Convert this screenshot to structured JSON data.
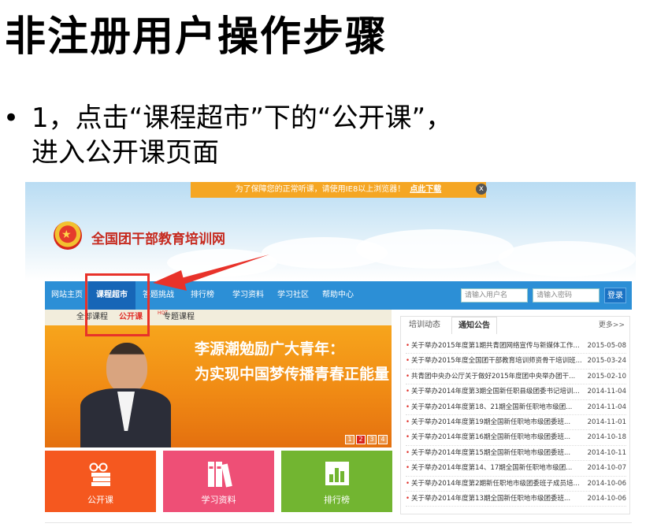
{
  "slide": {
    "title": "非注册用户操作步骤",
    "bullet": "•",
    "line1": "1，点击“课程超市”下的“公开课”，",
    "line2": "进入公开课页面"
  },
  "notice": {
    "text": "为了保障您的正常听课，请使用IE8以上浏览器！",
    "link": "点此下载",
    "close": "x"
  },
  "site": {
    "name": "全国团干部教育培训网"
  },
  "nav": {
    "items": [
      "网站主页",
      "课程超市",
      "答题挑战",
      "排行榜",
      "学习资料",
      "学习社区",
      "帮助中心"
    ],
    "active": "课程超市",
    "username_placeholder": "请输入用户名",
    "password_placeholder": "请输入密码",
    "login": "登录"
  },
  "subnav": {
    "items": [
      "全部课程",
      "公开课",
      "专题课程"
    ],
    "active": "公开课",
    "hot": "HOT"
  },
  "banner": {
    "line1": "李源潮勉励广大青年：",
    "line2": "为实现中国梦传播青春正能量",
    "pages": [
      "1",
      "2",
      "3",
      "4"
    ],
    "active_page": "2"
  },
  "tiles": [
    {
      "label": "公开课",
      "color": "#f5581f"
    },
    {
      "label": "学习资料",
      "color": "#ee4f76"
    },
    {
      "label": "排行榜",
      "color": "#72b531"
    }
  ],
  "news": {
    "tabs": [
      "培训动态",
      "通知公告"
    ],
    "active_tab": "通知公告",
    "more": "更多>>",
    "bullet": "•",
    "rows": [
      {
        "title": "关于举办2015年度第1期共青团网络宣传与新媒体工作...",
        "date": "2015-05-08"
      },
      {
        "title": "关于举办2015年度全国团干部教育培训师资骨干培训班...",
        "date": "2015-03-24"
      },
      {
        "title": "共青团中央办公厅关于做好2015年度团中央举办团干...",
        "date": "2015-02-10"
      },
      {
        "title": "关于举办2014年度第3期全国新任职县级团委书记培训...",
        "date": "2014-11-04"
      },
      {
        "title": "关于举办2014年度第18、21期全国新任职地市级团...",
        "date": "2014-11-04"
      },
      {
        "title": "关于举办2014年度第19期全国新任职地市级团委班...",
        "date": "2014-11-01"
      },
      {
        "title": "关于举办2014年度第16期全国新任职地市级团委班...",
        "date": "2014-10-18"
      },
      {
        "title": "关于举办2014年度第15期全国新任职地市级团委班...",
        "date": "2014-10-11"
      },
      {
        "title": "关于举办2014年度第14、17期全国新任职地市级团...",
        "date": "2014-10-07"
      },
      {
        "title": "关于举办2014年度第2期新任职地市级团委班子成员培...",
        "date": "2014-10-06"
      },
      {
        "title": "关于举办2014年度第13期全国新任职地市级团委班...",
        "date": "2014-10-06"
      }
    ]
  },
  "annotation": {
    "color": "#e8322a"
  }
}
